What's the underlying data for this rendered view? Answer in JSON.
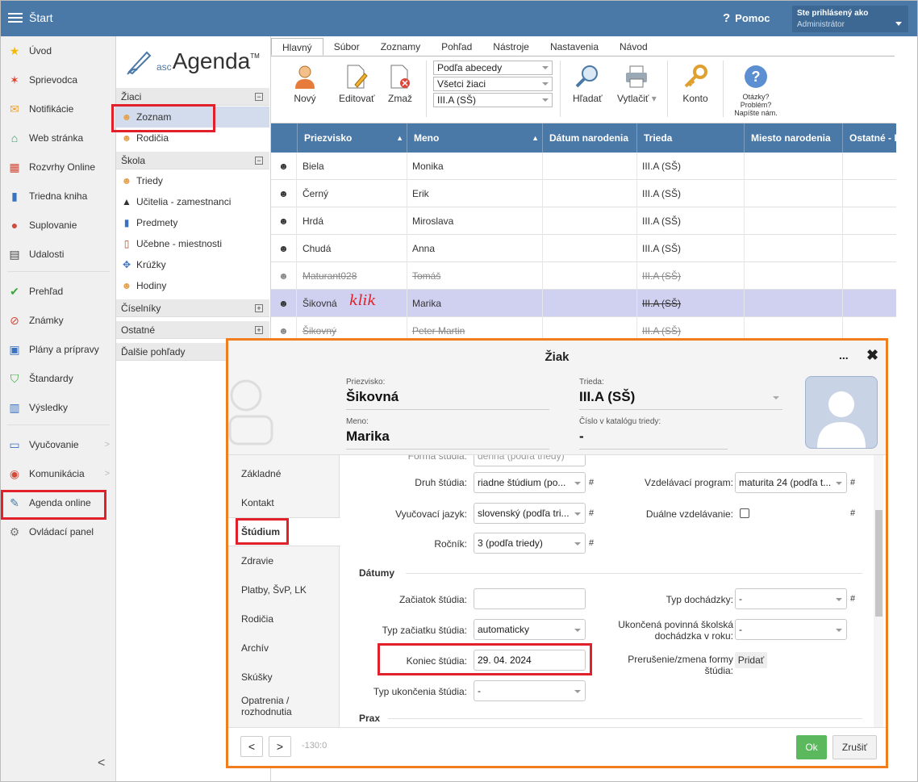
{
  "topbar": {
    "title": "Štart",
    "help": "Pomoc",
    "login_label": "Ste prihlásený ako",
    "login_role": "Administrátor"
  },
  "leftnav": {
    "items": [
      {
        "label": "Úvod",
        "icon": "star-icon"
      },
      {
        "label": "Sprievodca",
        "icon": "wand-icon"
      },
      {
        "label": "Notifikácie",
        "icon": "envelope-icon"
      },
      {
        "label": "Web stránka",
        "icon": "house-icon"
      },
      {
        "label": "Rozvrhy Online",
        "icon": "grid-icon"
      },
      {
        "label": "Triedna kniha",
        "icon": "book-icon"
      },
      {
        "label": "Suplovanie",
        "icon": "person-icon"
      },
      {
        "label": "Udalosti",
        "icon": "calendar-icon"
      },
      {
        "label": "Prehľad",
        "icon": "check-circle-icon"
      },
      {
        "label": "Známky",
        "icon": "grade-icon"
      },
      {
        "label": "Plány a prípravy",
        "icon": "briefcase-icon"
      },
      {
        "label": "Štandardy",
        "icon": "shield-check-icon"
      },
      {
        "label": "Výsledky",
        "icon": "bar-chart-icon"
      },
      {
        "label": "Vyučovanie",
        "icon": "open-book-icon"
      },
      {
        "label": "Komunikácia",
        "icon": "chat-icon"
      },
      {
        "label": "Agenda online",
        "icon": "pen-icon"
      },
      {
        "label": "Ovládací panel",
        "icon": "gear-icon"
      }
    ]
  },
  "logo": {
    "asc": "asc",
    "agenda": "Agenda",
    "tm": "TM"
  },
  "secpanel": {
    "sections": {
      "ziaci": "Žiaci",
      "skola": "Škola",
      "ciselniky": "Číselníky",
      "ostatne": "Ostatné",
      "dalsie": "Ďalšie pohľady"
    },
    "items": {
      "zoznam": "Zoznam",
      "rodicia": "Rodičia",
      "triedy": "Triedy",
      "ucitelia": "Učitelia - zamestnanci",
      "predmety": "Predmety",
      "ucebne": "Učebne - miestnosti",
      "kruzky": "Krúžky",
      "hodiny": "Hodiny"
    }
  },
  "ribbon": {
    "tabs": [
      "Hlavný",
      "Súbor",
      "Zoznamy",
      "Pohľad",
      "Nástroje",
      "Nastavenia",
      "Návod"
    ],
    "novy": "Nový",
    "editovat": "Editovať",
    "zmaz": "Zmaž",
    "sel1": "Podľa abecedy",
    "sel2": "Všetci žiaci",
    "sel3": "III.A (SŠ)",
    "hladat": "Hľadať",
    "vytlacit": "Vytlačiť",
    "konto": "Konto",
    "otazky1": "Otázky?",
    "otazky2": "Problém?",
    "otazky3": "Napíšte nám."
  },
  "grid": {
    "headers": {
      "priezvisko": "Priezvisko",
      "meno": "Meno",
      "datum": "Dátum narodenia",
      "trieda": "Trieda",
      "miesto": "Miesto narodenia",
      "ostatne": "Ostatné - I"
    },
    "rows": [
      {
        "priezvisko": "Biela",
        "meno": "Monika",
        "trieda": "III.A (SŠ)"
      },
      {
        "priezvisko": "Černý",
        "meno": "Erik",
        "trieda": "III.A (SŠ)"
      },
      {
        "priezvisko": "Hrdá",
        "meno": "Miroslava",
        "trieda": "III.A (SŠ)"
      },
      {
        "priezvisko": "Chudá",
        "meno": "Anna",
        "trieda": "III.A (SŠ)"
      },
      {
        "priezvisko": "Maturant028",
        "meno": "Tomáš",
        "trieda": "III.A (SŠ)"
      },
      {
        "priezvisko": "Šikovná",
        "meno": "Marika",
        "trieda": "III.A (SŠ)"
      },
      {
        "priezvisko": "Šikovný",
        "meno": "Peter Martin",
        "trieda": "III.A (SŠ)"
      }
    ]
  },
  "annotation": {
    "klik": "klik"
  },
  "dialog": {
    "title": "Žiak",
    "more": "...",
    "close": "✖",
    "priezvisko_label": "Priezvisko:",
    "priezvisko": "Šikovná",
    "trieda_label": "Trieda:",
    "trieda": "III.A (SŠ)",
    "meno_label": "Meno:",
    "meno": "Marika",
    "cislo_label": "Číslo v katalógu triedy:",
    "cislo": "-",
    "tabs": [
      "Základné",
      "Kontakt",
      "Štúdium",
      "Zdravie",
      "Platby, ŠvP, LK",
      "Rodičia",
      "Archív",
      "Skúšky",
      "Opatrenia / rozhodnutia"
    ],
    "form": {
      "forma_label": "Forma štúdia:",
      "forma": "denná (podľa triedy)",
      "druh_label": "Druh štúdia:",
      "druh": "riadne štúdium (po...",
      "jazyk_label": "Vyučovací jazyk:",
      "jazyk": "slovenský (podľa tri...",
      "rocnik_label": "Ročník:",
      "rocnik": "3 (podľa triedy)",
      "vzdel_label": "Vzdelávací program:",
      "vzdel": "maturita 24 (podľa t...",
      "dualne_label": "Duálne vzdelávanie:",
      "datumy": "Dátumy",
      "zaciatok_label": "Začiatok štúdia:",
      "zaciatok": "",
      "typ_zac_label": "Typ začiatku štúdia:",
      "typ_zac": "automaticky",
      "koniec_label": "Koniec štúdia:",
      "koniec": "29. 04. 2024",
      "typ_uk_label": "Typ ukončenia štúdia:",
      "typ_uk": "-",
      "typ_doch_label": "Typ dochádzky:",
      "typ_doch": "-",
      "ukon_label1": "Ukončená povinná školská",
      "ukon_label2": "dochádzka v roku:",
      "ukon": "-",
      "prerus_label1": "Prerušenie/zmena formy",
      "prerus_label2": "štúdia:",
      "pridat": "Pridať",
      "prax": "Prax",
      "hash": "#"
    },
    "footer": {
      "prev": "<",
      "next": ">",
      "counter": "-130:0",
      "ok": "Ok",
      "cancel": "Zrušiť"
    }
  },
  "colors": {
    "accent": "#4a79a8",
    "highlight_red": "#e0202a",
    "dialog_border": "#f07d1e",
    "ok_green": "#5cb85c",
    "selected_row": "#d0d1f0"
  }
}
